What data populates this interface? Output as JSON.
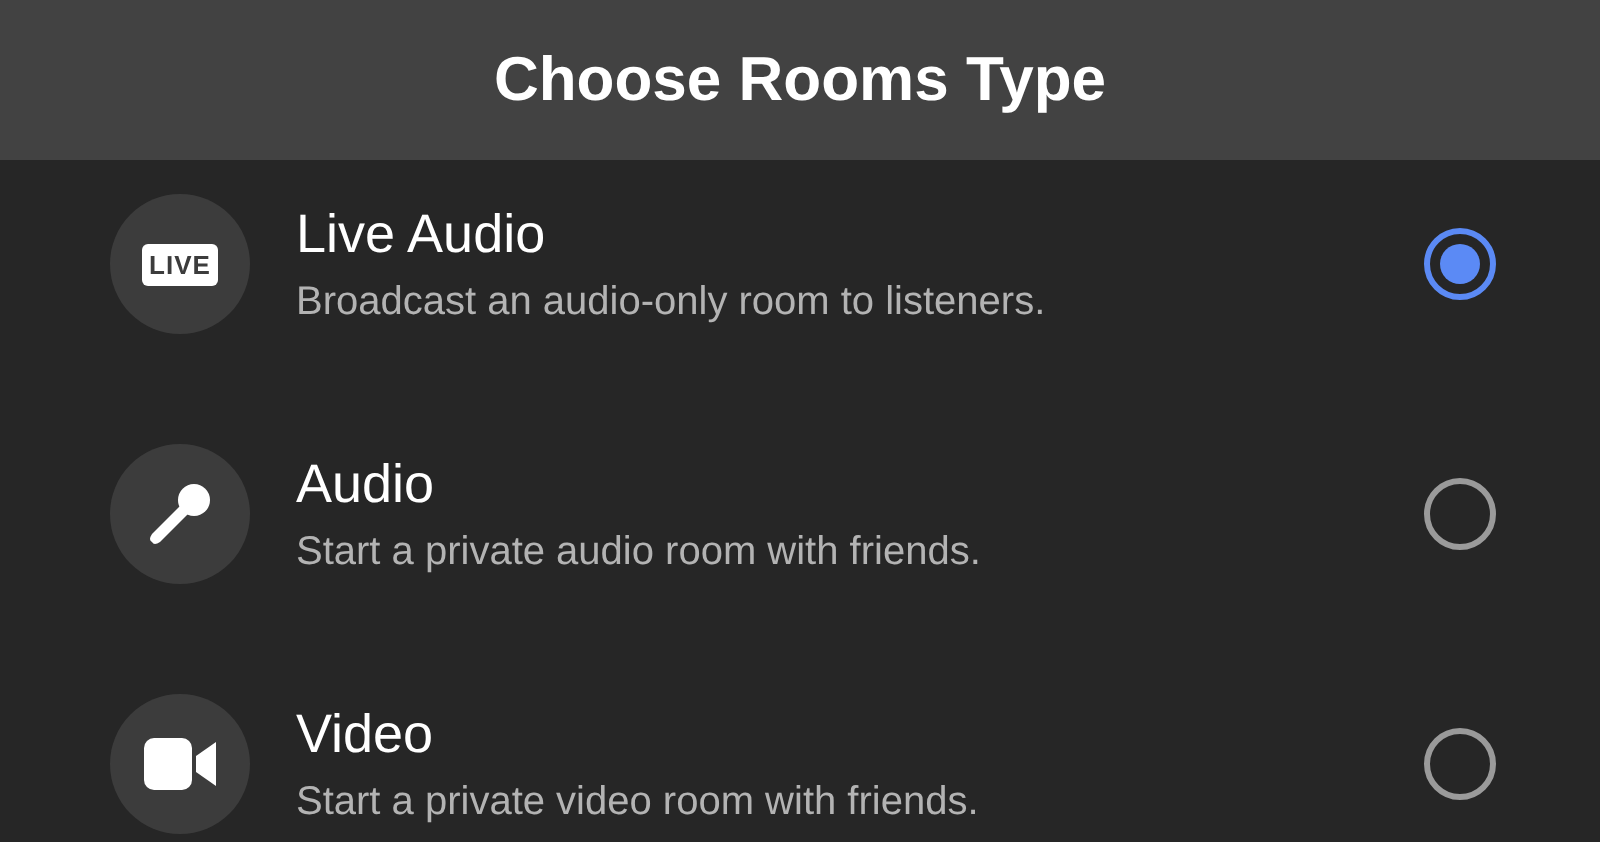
{
  "header": {
    "title": "Choose Rooms Type"
  },
  "options": [
    {
      "kind": "live",
      "icon_text": "LIVE",
      "title": "Live Audio",
      "description": "Broadcast an audio-only room to listeners.",
      "selected": true
    },
    {
      "kind": "audio",
      "title": "Audio",
      "description": "Start a private audio room with friends.",
      "selected": false
    },
    {
      "kind": "video",
      "title": "Video",
      "description": "Start a private video room with friends.",
      "selected": false
    }
  ]
}
